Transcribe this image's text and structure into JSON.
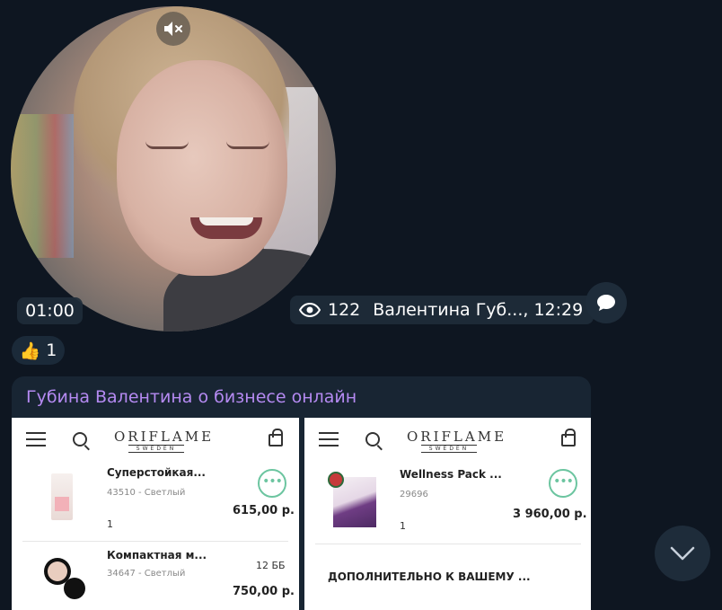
{
  "video": {
    "duration": "01:00",
    "views": "122",
    "author_time": "Валентина Губ..., 12:29"
  },
  "reaction": {
    "emoji": "👍",
    "count": "1"
  },
  "post": {
    "channel_title": "Губина Валентина о бизнесе онлайн",
    "screens": [
      {
        "logo": "ORIFLAME",
        "logo_sub": "SWEDEN",
        "products": [
          {
            "name": "Суперстойкая...",
            "code": "43510 - Светлый",
            "qty": "1",
            "price": "615,00 р."
          },
          {
            "name": "Компактная м...",
            "code": "34647 - Светлый",
            "qty": "",
            "bb": "12 ББ",
            "price": "750,00 р."
          }
        ]
      },
      {
        "logo": "ORIFLAME",
        "logo_sub": "SWEDEN",
        "products": [
          {
            "name": "Wellness Pack ...",
            "code": "29696",
            "qty": "1",
            "price": "3 960,00 р."
          }
        ],
        "extra_heading": "ДОПОЛНИТЕЛЬНО К ВАШЕМУ ..."
      }
    ]
  },
  "more_glyph": "•••",
  "icons": {
    "mute": "speaker-muted-icon",
    "eye": "eye-icon",
    "comment": "speech-bubble-icon",
    "scroll": "chevron-down-icon"
  },
  "colors": {
    "background": "#0e1621",
    "pill": "#1e2c3a",
    "channel_title": "#b58af2",
    "accent_green": "#6cc5a0"
  }
}
